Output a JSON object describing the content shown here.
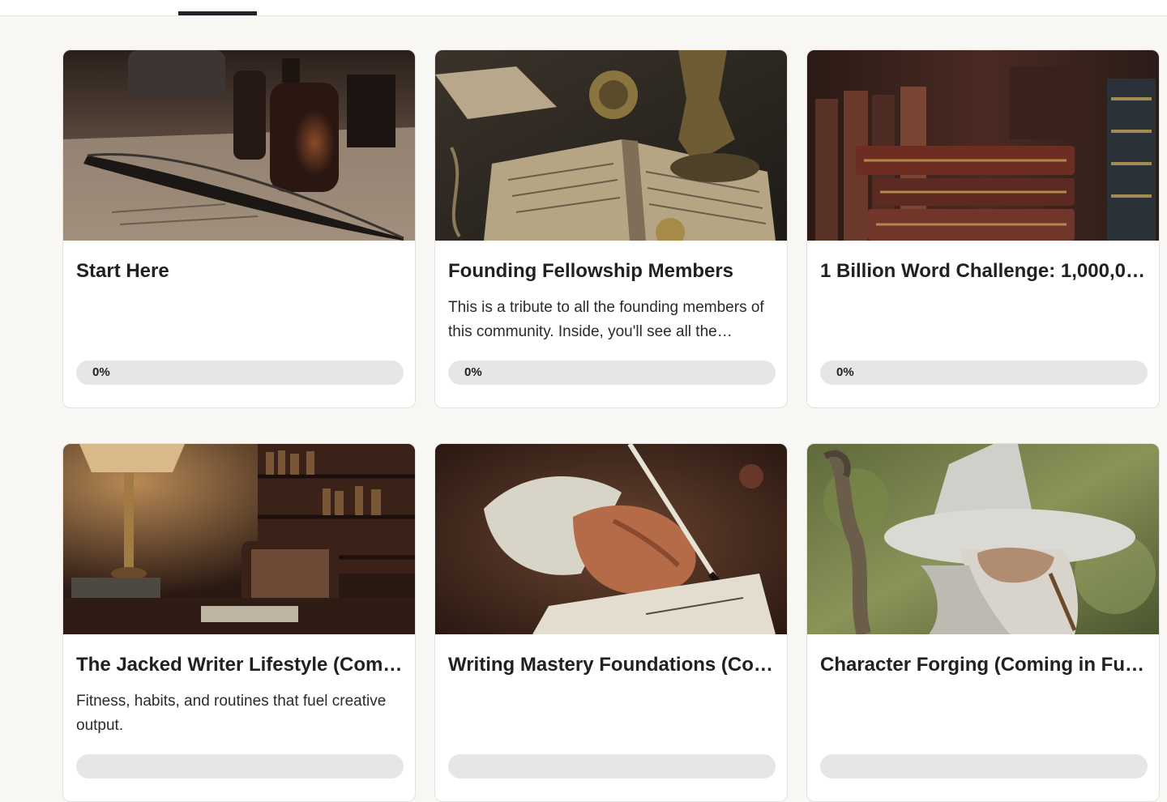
{
  "header": {
    "active_tab_accent": "#202124"
  },
  "colors": {
    "page_background": "#f8f7f4",
    "card_background": "#ffffff",
    "progress_track": "#e6e6e6",
    "title_text": "#202124"
  },
  "courses": [
    {
      "title": "Start Here",
      "description": "",
      "progress_label": "0%",
      "progress": 0,
      "image": "quill-and-ink-bottle-image"
    },
    {
      "title": "Founding Fellowship Members",
      "description": "This is a tribute to all the founding members of this community. Inside, you'll see all the…",
      "progress_label": "0%",
      "progress": 0,
      "image": "antique-open-book-image"
    },
    {
      "title": "1 Billion Word Challenge: 1,000,0…",
      "description": "",
      "progress_label": "0%",
      "progress": 0,
      "image": "stacked-leather-books-image"
    },
    {
      "title": "The Jacked Writer Lifestyle (Comi…",
      "description": "Fitness, habits, and routines that fuel creative output.",
      "progress_label": "",
      "progress": 0,
      "image": "study-room-with-lamp-image"
    },
    {
      "title": "Writing Mastery Foundations (Co…",
      "description": "",
      "progress_label": "",
      "progress": 0,
      "image": "hand-writing-with-quill-image"
    },
    {
      "title": "Character Forging (Coming in Fut…",
      "description": "",
      "progress_label": "",
      "progress": 0,
      "image": "wizard-with-staff-image"
    }
  ]
}
